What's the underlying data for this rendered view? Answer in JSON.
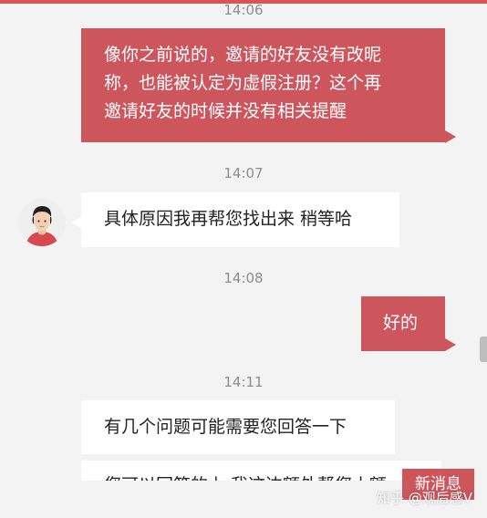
{
  "colors": {
    "accent": "#cd565d",
    "page_bg": "#f3f3f3",
    "incoming_bg": "#ffffff",
    "timestamp": "#8d8d8d"
  },
  "timestamps": {
    "t1": "14:06",
    "t2": "14:07",
    "t3": "14:08",
    "t4": "14:11"
  },
  "messages": [
    {
      "direction": "outgoing",
      "lines": [
        "像你之前说的，邀请的好友没有改昵",
        "称，也能被认定为虚假注册？这个再",
        "邀请好友的时候并没有相关提醒"
      ]
    },
    {
      "direction": "incoming",
      "text": "具体原因我再帮您找出来 稍等哈"
    },
    {
      "direction": "outgoing",
      "text": "好的"
    },
    {
      "direction": "incoming",
      "text": "有几个问题可能需要您回答一下"
    },
    {
      "direction": "incoming",
      "text": "您可以回答的上 我这边额外帮您小额"
    }
  ],
  "new_message_button": "新消息",
  "watermark": "知乎 @观后感V"
}
